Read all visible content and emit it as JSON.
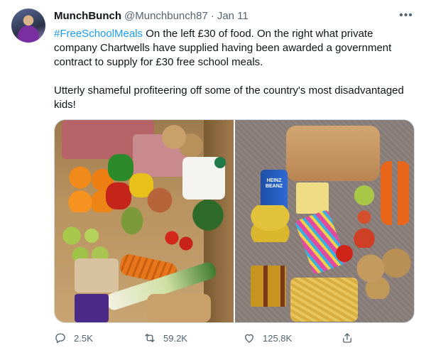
{
  "tweet": {
    "display_name": "MunchBunch",
    "handle": "@Munchbunch87",
    "separator": "·",
    "date": "Jan 11",
    "hashtag": "#FreeSchoolMeals",
    "paragraph1_rest": " On the left £30 of food. On the right what private company Chartwells have supplied having been awarded a government contract to supply for £30 free school meals.",
    "paragraph2": "Utterly shameful profiteering off some of the country's most disadvantaged kids!",
    "more_glyph": "•••"
  },
  "media": {
    "bean_can_label_line1": "HEINZ",
    "bean_can_label_line2": "BEANZ"
  },
  "actions": {
    "replies": "2.5K",
    "retweets": "59.2K",
    "likes": "125.8K"
  },
  "icons": [
    "avatar",
    "more-icon",
    "reply-icon",
    "retweet-icon",
    "like-icon",
    "share-icon"
  ],
  "colors": {
    "accent": "#1d9bf0",
    "secondary_text": "#536471",
    "text": "#0f1419"
  }
}
